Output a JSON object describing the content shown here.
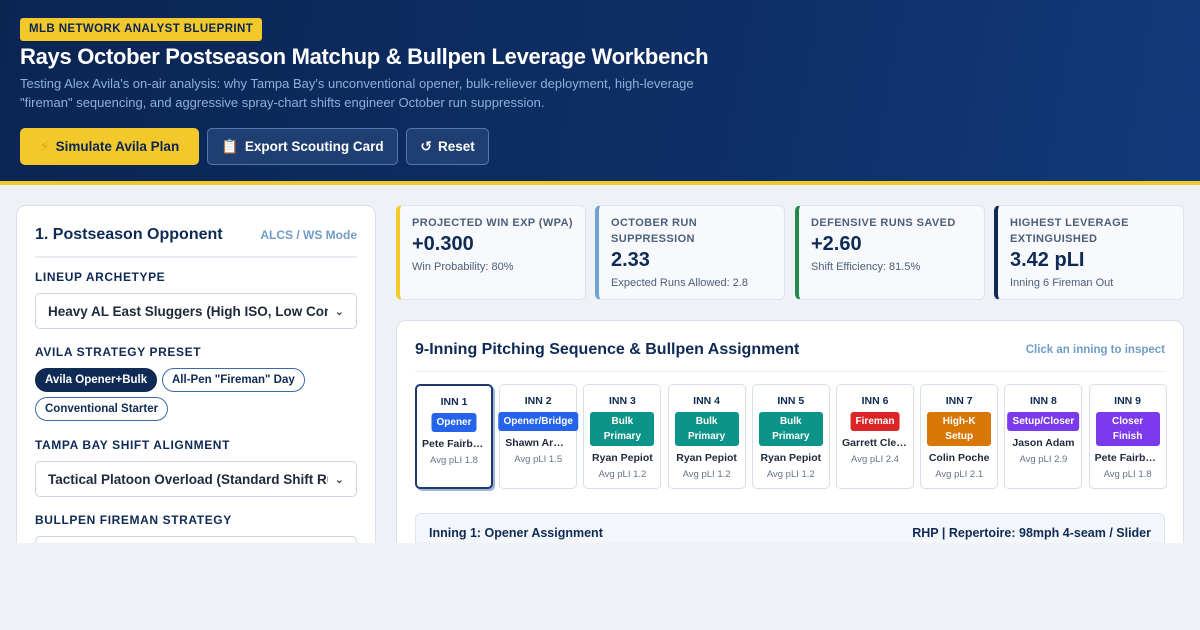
{
  "header": {
    "badge": "MLB NETWORK ANALYST BLUEPRINT",
    "title": "Rays October Postseason Matchup & Bullpen Leverage Workbench",
    "subtitle": "Testing Alex Avila's on-air analysis: why Tampa Bay's unconventional opener, bulk-reliever deployment, high-leverage \"fireman\" sequencing, and aggressive spray-chart shifts engineer October run suppression.",
    "buttons": {
      "simulate": "Simulate Avila Plan",
      "export": "Export Scouting Card",
      "reset": "Reset"
    },
    "icons": {
      "simulate": "lightning-icon",
      "export": "clipboard-icon",
      "reset": "refresh-icon"
    }
  },
  "opponent_panel": {
    "title": "1. Postseason Opponent",
    "mode": "ALCS / WS Mode",
    "lineup_label": "LINEUP ARCHETYPE",
    "lineup_value": "Heavy AL East Sluggers (High ISO, Low Contact)",
    "preset_label": "AVILA STRATEGY PRESET",
    "presets": [
      "Avila Opener+Bulk",
      "All-Pen \"Fireman\" Day",
      "Conventional Starter"
    ],
    "preset_active": 0,
    "shift_label": "TAMPA BAY SHIFT ALIGNMENT",
    "shift_value": "Tactical Platoon Overload (Standard Shift Rules)",
    "fireman_label": "BULLPEN FIREMAN STRATEGY"
  },
  "kpis": [
    {
      "label": "PROJECTED WIN EXP (WPA)",
      "value": "+0.300",
      "sub": "Win Probability: 80%",
      "accent": "#f2c82b"
    },
    {
      "label": "OCTOBER RUN SUPPRESSION",
      "value": "2.33",
      "sub": "Expected Runs Allowed: 2.8",
      "accent": "#6fa2cf"
    },
    {
      "label": "DEFENSIVE RUNS SAVED",
      "value": "+2.60",
      "sub": "Shift Efficiency: 81.5%",
      "accent": "#1f8a4c"
    },
    {
      "label": "HIGHEST LEVERAGE EXTINGUISHED",
      "value": "3.42 pLI",
      "sub": "Inning 6 Fireman Out",
      "accent": "#0f2a55"
    }
  ],
  "sequence": {
    "title": "9-Inning Pitching Sequence & Bullpen Assignment",
    "hint": "Click an inning to inspect",
    "innings": [
      {
        "label": "INN 1",
        "role": "Opener",
        "color": "#2563eb",
        "pitcher": "Pete Fairbanks",
        "pli": "Avg pLI 1.8"
      },
      {
        "label": "INN 2",
        "role": "Opener/Bridge",
        "color": "#2563eb",
        "pitcher": "Shawn Armstrong",
        "pli": "Avg pLI 1.5"
      },
      {
        "label": "INN 3",
        "role": "Bulk Primary",
        "color": "#0d9488",
        "pitcher": "Ryan Pepiot",
        "pli": "Avg pLI 1.2"
      },
      {
        "label": "INN 4",
        "role": "Bulk Primary",
        "color": "#0d9488",
        "pitcher": "Ryan Pepiot",
        "pli": "Avg pLI 1.2"
      },
      {
        "label": "INN 5",
        "role": "Bulk Primary",
        "color": "#0d9488",
        "pitcher": "Ryan Pepiot",
        "pli": "Avg pLI 1.2"
      },
      {
        "label": "INN 6",
        "role": "Fireman",
        "color": "#dc2626",
        "pitcher": "Garrett Cleavinger",
        "pli": "Avg pLI 2.4"
      },
      {
        "label": "INN 7",
        "role": "High-K Setup",
        "color": "#d97706",
        "pitcher": "Colin Poche",
        "pli": "Avg pLI 2.1"
      },
      {
        "label": "INN 8",
        "role": "Setup/Closer",
        "color": "#7c3aed",
        "pitcher": "Jason Adam",
        "pli": "Avg pLI 2.9"
      },
      {
        "label": "INN 9",
        "role": "Closer Finish",
        "color": "#7c3aed",
        "pitcher": "Pete Fairbanks",
        "pli": "Avg pLI 1.8"
      }
    ],
    "selected": 0,
    "detail_left": "Inning 1: Opener Assignment",
    "detail_right": "RHP | Repertoire: 98mph 4-seam / Slider"
  }
}
